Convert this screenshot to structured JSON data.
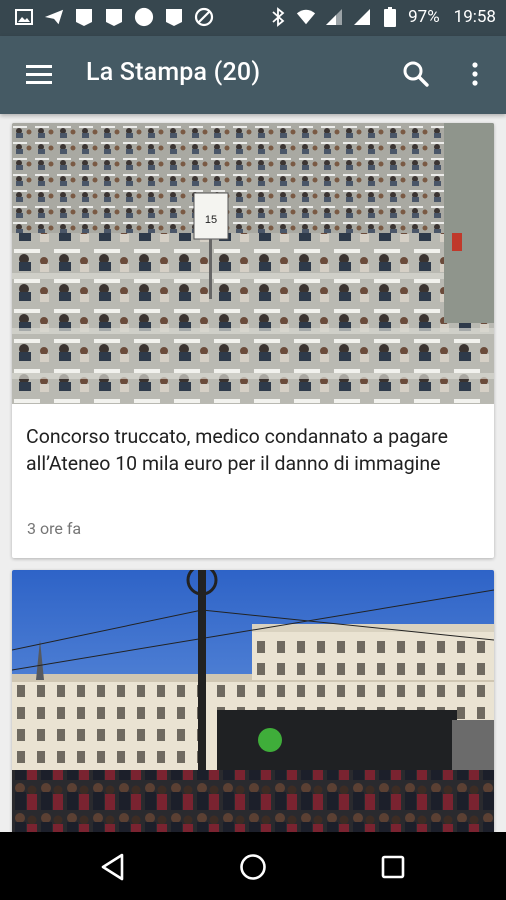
{
  "status_bar": {
    "battery": "97%",
    "time": "19:58",
    "left_icons": [
      "image-icon",
      "send-icon",
      "notification-icon",
      "notification-icon",
      "circle-icon",
      "notification-icon",
      "blocked-icon"
    ],
    "right_icons": [
      "bluetooth-icon",
      "wifi-icon",
      "signal-icon",
      "signal-icon",
      "battery-icon"
    ]
  },
  "app_bar": {
    "title": "La Stampa (20)",
    "icons": {
      "menu": "menu-icon",
      "search": "search-icon",
      "more": "more-vert-icon"
    }
  },
  "articles": [
    {
      "image": "exam-hall-photo",
      "title": "Concorso truccato, medico condannato a pagare all’Ateneo 10 mila euro per il danno di immagine",
      "time": "3 ore fa"
    },
    {
      "image": "city-square-crowd-photo"
    }
  ],
  "nav_bar": {
    "back": "back-icon",
    "home": "home-icon",
    "recents": "recents-icon"
  },
  "colors": {
    "status_bar": "#37474f",
    "app_bar": "#455a64",
    "background": "#eeeeee",
    "card": "#ffffff",
    "title_text": "#212121",
    "time_text": "#757575"
  }
}
